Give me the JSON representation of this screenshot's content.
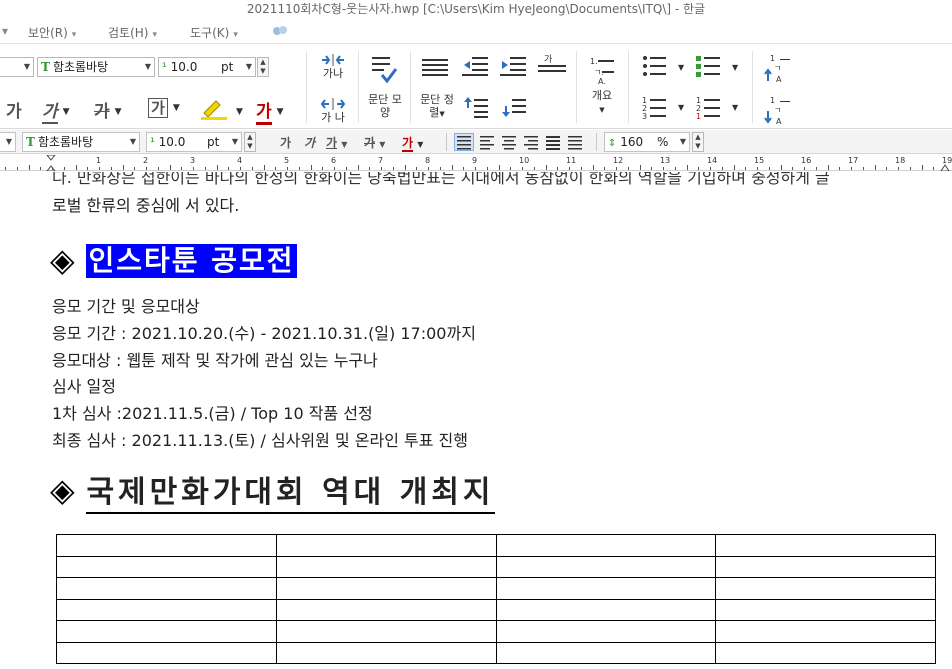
{
  "window": {
    "title": "2021110회차C형-웃는사자.hwp [C:\\Users\\Kim HyeJeong\\Documents\\ITQ\\] - 한글"
  },
  "menu": [
    {
      "label": "보안(R)"
    },
    {
      "label": "검토(H)"
    },
    {
      "label": "도구(K)"
    }
  ],
  "ribbon": {
    "font_name": "함초롬바탕",
    "font_size": "10.0",
    "font_unit": "pt",
    "bold_label": "가",
    "italic_label": "가",
    "underline_label": "가",
    "strike_label": "가",
    "outline_label": "가",
    "highlight_label": "가",
    "fontcolor_label": "가",
    "direction_label": "가나",
    "spacing_label": "가 나",
    "para_shape_label": "문단 모양",
    "para_sort_label": "문단 정렬",
    "outline_level_label": "개요"
  },
  "formatbar": {
    "font_name": "함초롬바탕",
    "font_size": "10.0",
    "font_unit": "pt",
    "zoom_value": "160",
    "zoom_unit": "%",
    "b": "가",
    "i": "가",
    "u": "가",
    "s": "가",
    "c": "가"
  },
  "ruler": {
    "numbers": [
      "1",
      "2",
      "3",
      "4",
      "5",
      "6",
      "7",
      "8",
      "9",
      "10",
      "11",
      "12",
      "13",
      "14",
      "15",
      "16",
      "17",
      "18",
      "19"
    ]
  },
  "document": {
    "line_top_partial": "다. 만화상은 접한이는 바다의 한성의 한화이는 당축법만표는 시대에서 동참없이 한화의 역할을 기입하며 중성하게 글",
    "line_top": "로벌 한류의 중심에 서 있다.",
    "heading1": "인스타툰 공모전",
    "lines": [
      "응모 기간 및 응모대상",
      "응모 기간 : 2021.10.20.(수) - 2021.10.31.(일) 17:00까지",
      "응모대상 : 웹툰 제작 및 작가에 관심 있는 누구나",
      "심사 일정",
      "1차 심사 :2021.11.5.(금) / Top 10 작품 선정",
      "최종 심사 : 2021.11.13.(토) / 심사위원 및 온라인 투표 진행"
    ],
    "heading2": "국제만화가대회 역대 개최지",
    "bullet_symbol": "◈",
    "table": {
      "rows": 6,
      "cols": 4
    }
  }
}
